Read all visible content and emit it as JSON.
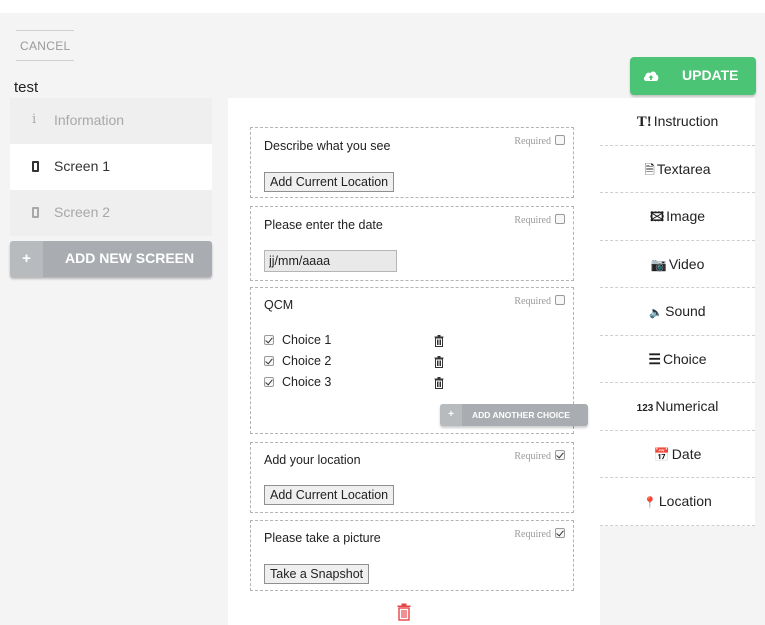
{
  "header": {
    "cancel_label": "CANCEL",
    "survey_title": "test",
    "update_label": "UPDATE",
    "update_icon": "cloud-upload-icon",
    "accent_color": "#4cc476"
  },
  "sidebar": {
    "items": [
      {
        "label": "Information",
        "icon": "info-icon"
      },
      {
        "label": "Screen 1",
        "icon": "phone-icon",
        "active": true
      },
      {
        "label": "Screen 2",
        "icon": "phone-icon"
      }
    ],
    "add_screen_label": "ADD NEW SCREEN",
    "add_screen_icon": "+"
  },
  "canvas": {
    "required_label": "Required",
    "fields": [
      {
        "title": "Describe what you see",
        "required": false,
        "button": "Add Current Location"
      },
      {
        "title": "Please enter the date",
        "required": false,
        "placeholder": "jj/mm/aaaa"
      },
      {
        "title": "QCM",
        "required": false,
        "choices": [
          "Choice 1",
          "Choice 2",
          "Choice 3"
        ],
        "add_choice_label": "ADD ANOTHER CHOICE",
        "add_choice_icon": "+"
      },
      {
        "title": "Add your location",
        "required": true,
        "button": "Add Current Location"
      },
      {
        "title": "Please take a picture",
        "required": true,
        "button": "Take a Snapshot"
      }
    ]
  },
  "toolbox": {
    "items": [
      {
        "icon": "T!",
        "label": "Instruction",
        "icon_name": "instruction-icon"
      },
      {
        "icon": "🗎",
        "label": "Textarea",
        "icon_name": "textarea-icon"
      },
      {
        "icon": "🖾",
        "label": "Image",
        "icon_name": "image-icon"
      },
      {
        "icon": "📷",
        "label": "Video",
        "icon_name": "camera-icon"
      },
      {
        "icon": "🔈",
        "label": "Sound",
        "icon_name": "speaker-icon"
      },
      {
        "icon": "☰",
        "label": "Choice",
        "icon_name": "list-icon"
      },
      {
        "icon": "123",
        "label": "Numerical",
        "icon_name": "numeric-icon"
      },
      {
        "icon": "📅",
        "label": "Date",
        "icon_name": "calendar-icon"
      },
      {
        "icon": "📍",
        "label": "Location",
        "icon_name": "map-marker-icon"
      }
    ]
  }
}
